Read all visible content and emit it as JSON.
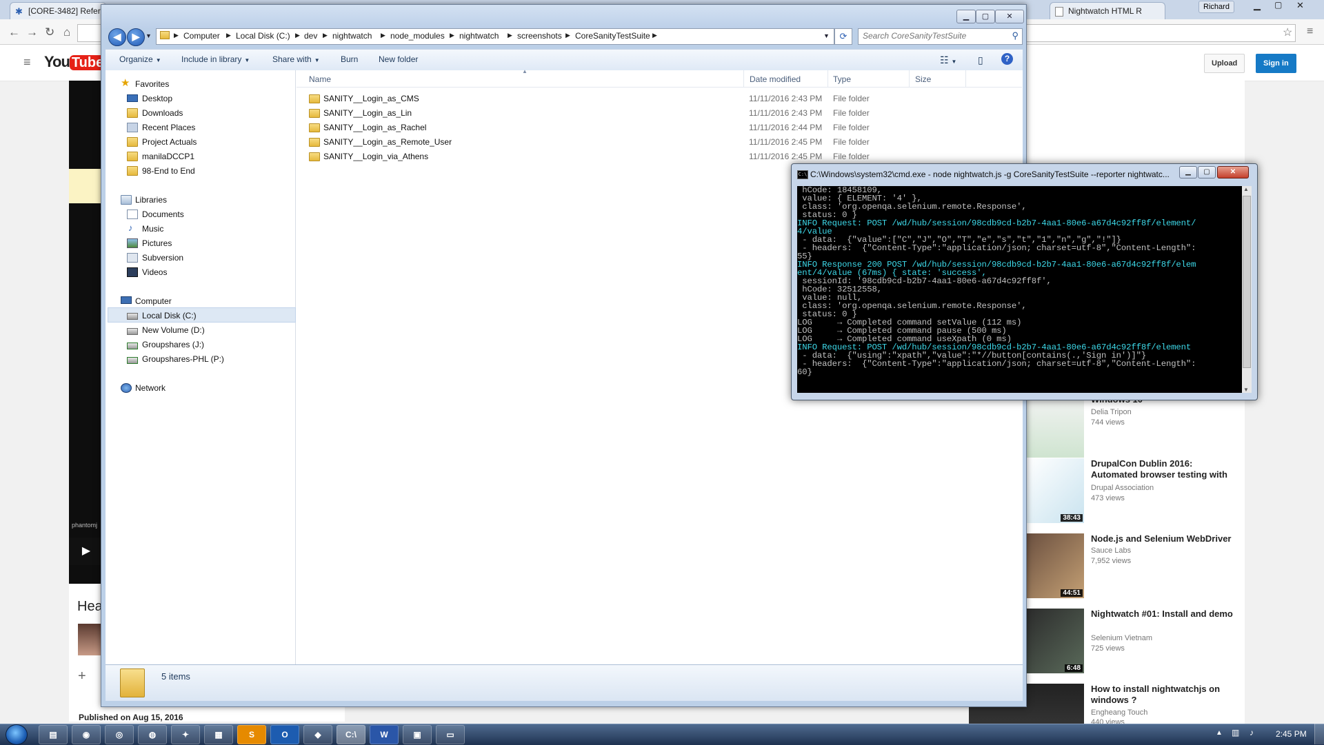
{
  "chrome": {
    "tabs": [
      {
        "label": "[CORE-3482] Refer"
      },
      {
        "label": "Nightwatch HTML R"
      }
    ],
    "user": "Richard"
  },
  "youtube": {
    "upload": "Upload",
    "signin": "Sign in",
    "heading_fragment": "Hea",
    "published": "Published on Aug 15, 2016",
    "phantom_text": "phantomj",
    "videos": [
      {
        "title": "Windows 10",
        "channel": "Delia Tripon",
        "views": "744 views",
        "duration": ""
      },
      {
        "title": "DrupalCon Dublin 2016: Automated browser testing with",
        "channel": "Drupal Association",
        "views": "473 views",
        "duration": "38:43"
      },
      {
        "title": "Node.js and Selenium WebDriver",
        "channel": "Sauce Labs",
        "views": "7,952 views",
        "duration": "44:51"
      },
      {
        "title": "Nightwatch #01: Install and demo",
        "channel": "Selenium Vietnam",
        "views": "725 views",
        "duration": "6:48"
      },
      {
        "title": "How to install nightwatchjs on windows ?",
        "channel": "Engheang Touch",
        "views": "440 views",
        "duration": ""
      }
    ]
  },
  "explorer": {
    "breadcrumb": [
      "Computer",
      "Local Disk (C:)",
      "dev",
      "nightwatch",
      "node_modules",
      "nightwatch",
      "screenshots",
      "CoreSanityTestSuite"
    ],
    "search_placeholder": "Search CoreSanityTestSuite",
    "toolbar": {
      "organize": "Organize",
      "include": "Include in library",
      "share": "Share with",
      "burn": "Burn",
      "new_folder": "New folder"
    },
    "nav": {
      "favorites": "Favorites",
      "favorite_items": [
        "Desktop",
        "Downloads",
        "Recent Places",
        "Project Actuals",
        "manilaDCCP1",
        "98-End to End"
      ],
      "libraries": "Libraries",
      "library_items": [
        "Documents",
        "Music",
        "Pictures",
        "Subversion",
        "Videos"
      ],
      "computer": "Computer",
      "computer_items": [
        "Local Disk (C:)",
        "New Volume (D:)",
        "Groupshares (J:)",
        "Groupshares-PHL (P:)"
      ],
      "network": "Network"
    },
    "columns": {
      "name": "Name",
      "date": "Date modified",
      "type": "Type",
      "size": "Size"
    },
    "files": [
      {
        "name": "SANITY__Login_as_CMS",
        "date": "11/11/2016 2:43 PM",
        "type": "File folder"
      },
      {
        "name": "SANITY__Login_as_Lin",
        "date": "11/11/2016 2:43 PM",
        "type": "File folder"
      },
      {
        "name": "SANITY__Login_as_Rachel",
        "date": "11/11/2016 2:44 PM",
        "type": "File folder"
      },
      {
        "name": "SANITY__Login_as_Remote_User",
        "date": "11/11/2016 2:45 PM",
        "type": "File folder"
      },
      {
        "name": "SANITY__Login_via_Athens",
        "date": "11/11/2016 2:45 PM",
        "type": "File folder"
      }
    ],
    "item_count": "5 items"
  },
  "cmd": {
    "title": "C:\\Windows\\system32\\cmd.exe - node  nightwatch.js -g CoreSanityTestSuite --reporter nightwatc...",
    "lines": [
      " hCode: 18458109,",
      " value: { ELEMENT: '4' },",
      " class: 'org.openqa.selenium.remote.Response',",
      " status: 0 }",
      "INFO Request: POST /wd/hub/session/98cdb9cd-b2b7-4aa1-80e6-a67d4c92ff8f/element/",
      "4/value",
      " - data:  {\"value\":[\"C\",\"J\",\"O\",\"T\",\"e\",\"s\",\"t\",\"1\",\"n\",\"g\",\"!\"]}",
      " - headers:  {\"Content-Type\":\"application/json; charset=utf-8\",\"Content-Length\":",
      "55}",
      "INFO Response 200 POST /wd/hub/session/98cdb9cd-b2b7-4aa1-80e6-a67d4c92ff8f/elem",
      "ent/4/value (67ms) { state: 'success',",
      " sessionId: '98cdb9cd-b2b7-4aa1-80e6-a67d4c92ff8f',",
      " hCode: 32512558,",
      " value: null,",
      " class: 'org.openqa.selenium.remote.Response',",
      " status: 0 }",
      "LOG     → Completed command setValue (112 ms)",
      "LOG     → Completed command pause (500 ms)",
      "LOG     → Completed command useXpath (0 ms)",
      "INFO Request: POST /wd/hub/session/98cdb9cd-b2b7-4aa1-80e6-a67d4c92ff8f/element",
      "",
      " - data:  {\"using\":\"xpath\",\"value\":\"*//button[contains(.,'Sign in')]\"}",
      " - headers:  {\"Content-Type\":\"application/json; charset=utf-8\",\"Content-Length\":",
      "60}"
    ]
  },
  "taskbar": {
    "clock": "2:45 PM",
    "apps": [
      "IE",
      "Chrome",
      "Firefox",
      "S",
      "O",
      "cmd",
      "W",
      "PDF"
    ]
  }
}
